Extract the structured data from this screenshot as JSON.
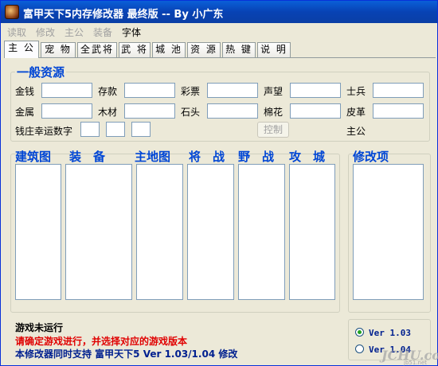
{
  "window": {
    "title": "富甲天下5内存修改器 最终版 -- By 小广东"
  },
  "menu": [
    {
      "label": "读取",
      "enabled": false
    },
    {
      "label": "修改",
      "enabled": false
    },
    {
      "label": "主公",
      "enabled": false
    },
    {
      "label": "装备",
      "enabled": false
    },
    {
      "label": "字体",
      "enabled": true
    }
  ],
  "tabs": [
    "主 公",
    "宠 物",
    "全武将",
    "武 将",
    "城 池",
    "资 源",
    "热 键",
    "说 明"
  ],
  "general_resources": {
    "title": "一般资源",
    "fields": [
      {
        "label": "金钱",
        "value": ""
      },
      {
        "label": "存款",
        "value": ""
      },
      {
        "label": "彩票",
        "value": ""
      },
      {
        "label": "声望",
        "value": ""
      },
      {
        "label": "士兵",
        "value": ""
      },
      {
        "label": "金属",
        "value": ""
      },
      {
        "label": "木材",
        "value": ""
      },
      {
        "label": "石头",
        "value": ""
      },
      {
        "label": "棉花",
        "value": ""
      },
      {
        "label": "皮革",
        "value": ""
      }
    ],
    "lucky_label": "钱庄幸运数字",
    "lucky_values": [
      "",
      "",
      ""
    ],
    "control_button": "控制",
    "lord_label": "主公"
  },
  "lists": {
    "headers": [
      "建筑图",
      "装　备",
      "主地图",
      "将　战",
      "野　战",
      "攻　城"
    ],
    "modify_title": "修改项"
  },
  "status": {
    "line1": "游戏未运行",
    "line2": "请确定游戏进行，并选择对应的游戏版本",
    "line3": "本修改器同时支持 富甲天下5 Ver 1.03/1.04 修改"
  },
  "versions": [
    {
      "label": "Ver 1.03",
      "selected": true
    },
    {
      "label": "Ver 1.04",
      "selected": false
    }
  ],
  "watermark": {
    "main": "JCHU.com",
    "sub": "jb51.net"
  }
}
